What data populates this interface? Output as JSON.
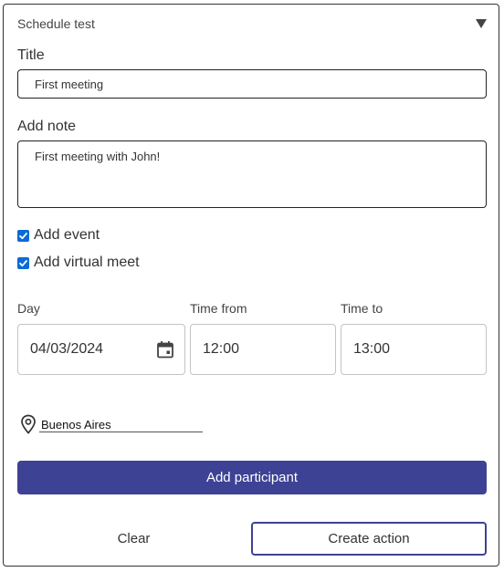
{
  "header": {
    "title": "Schedule test"
  },
  "form": {
    "title_label": "Title",
    "title_value": "First meeting",
    "note_label": "Add note",
    "note_value": "First meeting with John!",
    "add_event_label": "Add event",
    "add_event_checked": true,
    "add_virtual_meet_label": "Add virtual meet",
    "add_virtual_meet_checked": true,
    "day_label": "Day",
    "day_value": "04/03/2024",
    "time_from_label": "Time from",
    "time_from_value": "12:00",
    "time_to_label": "Time to",
    "time_to_value": "13:00",
    "location_value": "Buenos Aires"
  },
  "actions": {
    "add_participant_label": "Add participant",
    "clear_label": "Clear",
    "create_action_label": "Create action"
  },
  "icons": {
    "collapse": "triangle-down-icon",
    "checkbox": "check-icon",
    "calendar": "calendar-icon",
    "location": "location-pin-icon"
  },
  "colors": {
    "primary": "#3d4294",
    "checkbox": "#0b6bd6",
    "border": "#222222",
    "muted_border": "#c4c4c4"
  }
}
